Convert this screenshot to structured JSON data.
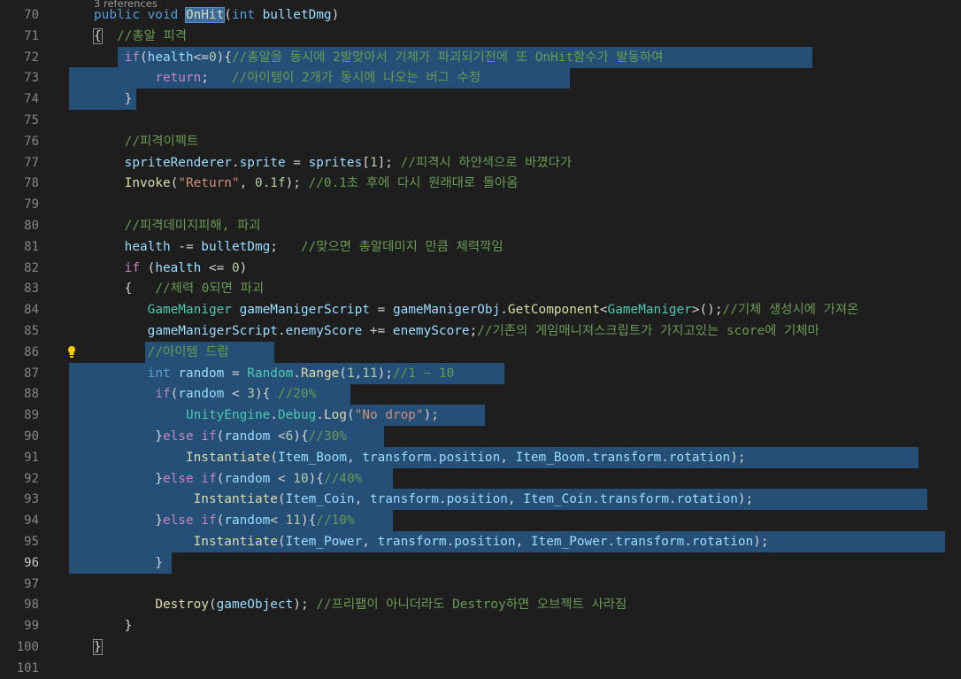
{
  "editor": {
    "codelens": "3 references",
    "lines": [
      {
        "n": "70",
        "tokens": [
          [
            "tk",
            "public void "
          ],
          [
            "fn hl",
            "OnHit"
          ],
          [
            "pl",
            "("
          ],
          [
            "tk",
            "int "
          ],
          [
            "vr",
            "bulletDmg"
          ],
          [
            "pl",
            ")"
          ]
        ]
      },
      {
        "n": "71",
        "tokens": [
          [
            "pl br",
            "{"
          ],
          [
            "cm",
            "  //총알 피격"
          ]
        ]
      },
      {
        "n": "72",
        "tokens": [
          [
            "pl",
            "    "
          ],
          [
            "pb",
            "if"
          ],
          [
            "pl",
            "("
          ],
          [
            "vr",
            "health"
          ],
          [
            "pl",
            "<="
          ],
          [
            "nm",
            "0"
          ],
          [
            "pl",
            "){"
          ],
          [
            "cm",
            "//총알을 동시에 2발맞아서 기체가 파괴되기전에 또 OnHit함수가 발동하여"
          ]
        ]
      },
      {
        "n": "73",
        "tokens": [
          [
            "pl",
            "        "
          ],
          [
            "pb",
            "return"
          ],
          [
            "pl",
            ";   "
          ],
          [
            "cm",
            "//아이템이 2개가 동시에 나오는 버그 수정"
          ]
        ]
      },
      {
        "n": "74",
        "tokens": [
          [
            "pl",
            "    }"
          ]
        ]
      },
      {
        "n": "75",
        "tokens": []
      },
      {
        "n": "76",
        "tokens": [
          [
            "pl",
            "    "
          ],
          [
            "cm",
            "//피격이펙트"
          ]
        ]
      },
      {
        "n": "77",
        "tokens": [
          [
            "pl",
            "    "
          ],
          [
            "vr",
            "spriteRenderer"
          ],
          [
            "pl",
            "."
          ],
          [
            "vr",
            "sprite"
          ],
          [
            "pl",
            " = "
          ],
          [
            "vr",
            "sprites"
          ],
          [
            "pl",
            "["
          ],
          [
            "nm",
            "1"
          ],
          [
            "pl",
            "]; "
          ],
          [
            "cm",
            "//피격시 하얀색으로 바꼈다가"
          ]
        ]
      },
      {
        "n": "78",
        "tokens": [
          [
            "pl",
            "    "
          ],
          [
            "fn",
            "Invoke"
          ],
          [
            "pl",
            "("
          ],
          [
            "st",
            "\"Return\""
          ],
          [
            "pl",
            ", "
          ],
          [
            "nm",
            "0.1f"
          ],
          [
            "pl",
            "); "
          ],
          [
            "cm",
            "//0.1초 후에 다시 원래대로 돌아옴"
          ]
        ]
      },
      {
        "n": "79",
        "tokens": []
      },
      {
        "n": "80",
        "tokens": [
          [
            "pl",
            "    "
          ],
          [
            "cm",
            "//피격데미지피해, 파괴"
          ]
        ]
      },
      {
        "n": "81",
        "tokens": [
          [
            "pl",
            "    "
          ],
          [
            "vr",
            "health"
          ],
          [
            "pl",
            " -= "
          ],
          [
            "vr",
            "bulletDmg"
          ],
          [
            "pl",
            ";   "
          ],
          [
            "cm",
            "//맞으면 총알데미지 만큼 체력깍임"
          ]
        ]
      },
      {
        "n": "82",
        "tokens": [
          [
            "pl",
            "    "
          ],
          [
            "pb",
            "if"
          ],
          [
            "pl",
            " ("
          ],
          [
            "vr",
            "health"
          ],
          [
            "pl",
            " <= "
          ],
          [
            "nm",
            "0"
          ],
          [
            "pl",
            ")"
          ]
        ]
      },
      {
        "n": "83",
        "tokens": [
          [
            "pl",
            "    {   "
          ],
          [
            "cm",
            "//체력 0되면 파괴"
          ]
        ]
      },
      {
        "n": "84",
        "tokens": [
          [
            "pl",
            "       "
          ],
          [
            "ty",
            "GameManiger"
          ],
          [
            "pl",
            " "
          ],
          [
            "vr",
            "gameManigerScript"
          ],
          [
            "pl",
            " = "
          ],
          [
            "vr",
            "gameManigerObj"
          ],
          [
            "pl",
            "."
          ],
          [
            "fn",
            "GetComponent"
          ],
          [
            "pl",
            "<"
          ],
          [
            "ty",
            "GameManiger"
          ],
          [
            "pl",
            ">();"
          ],
          [
            "cm",
            "//기체 생성시에 가져온"
          ]
        ]
      },
      {
        "n": "85",
        "tokens": [
          [
            "pl",
            "       "
          ],
          [
            "vr",
            "gameManigerScript"
          ],
          [
            "pl",
            "."
          ],
          [
            "vr",
            "enemyScore"
          ],
          [
            "pl",
            " += "
          ],
          [
            "vr",
            "enemyScore"
          ],
          [
            "pl",
            ";"
          ],
          [
            "cm",
            "//기존의 게임매니져스크립트가 가지고있는 score에 기체마"
          ]
        ]
      },
      {
        "n": "86",
        "tokens": [
          [
            "pl",
            "       "
          ],
          [
            "cm",
            "//아이템 드랍"
          ]
        ]
      },
      {
        "n": "87",
        "tokens": [
          [
            "pl",
            "       "
          ],
          [
            "tk",
            "int "
          ],
          [
            "vr",
            "random"
          ],
          [
            "pl",
            " = "
          ],
          [
            "ty",
            "Random"
          ],
          [
            "pl",
            "."
          ],
          [
            "fn",
            "Range"
          ],
          [
            "pl",
            "("
          ],
          [
            "nm",
            "1"
          ],
          [
            "pl",
            ","
          ],
          [
            "nm",
            "11"
          ],
          [
            "pl",
            ");"
          ],
          [
            "cm",
            "//1 ~ 10"
          ]
        ]
      },
      {
        "n": "88",
        "tokens": [
          [
            "pl",
            "        "
          ],
          [
            "pb",
            "if"
          ],
          [
            "pl",
            "("
          ],
          [
            "vr",
            "random"
          ],
          [
            "pl",
            " < "
          ],
          [
            "nm",
            "3"
          ],
          [
            "pl",
            ")"
          ],
          [
            "pl",
            "{ "
          ],
          [
            "cm",
            "//20%"
          ]
        ]
      },
      {
        "n": "89",
        "tokens": [
          [
            "pl",
            "            "
          ],
          [
            "ty",
            "UnityEngine"
          ],
          [
            "pl",
            "."
          ],
          [
            "ty",
            "Debug"
          ],
          [
            "pl",
            "."
          ],
          [
            "fn",
            "Log"
          ],
          [
            "pl",
            "("
          ],
          [
            "st",
            "\"No drop\""
          ],
          [
            "pl",
            ");"
          ]
        ]
      },
      {
        "n": "90",
        "tokens": [
          [
            "pl",
            "        }"
          ],
          [
            "pb",
            "else if"
          ],
          [
            "pl",
            "("
          ],
          [
            "vr",
            "random"
          ],
          [
            "pl",
            " <"
          ],
          [
            "nm",
            "6"
          ],
          [
            "pl",
            "){"
          ],
          [
            "cm",
            "//30%"
          ]
        ]
      },
      {
        "n": "91",
        "tokens": [
          [
            "pl",
            "            "
          ],
          [
            "fn",
            "Instantiate"
          ],
          [
            "pl",
            "("
          ],
          [
            "vr",
            "Item_Boom"
          ],
          [
            "pl",
            ", "
          ],
          [
            "vr",
            "transform"
          ],
          [
            "pl",
            "."
          ],
          [
            "vr",
            "position"
          ],
          [
            "pl",
            ", "
          ],
          [
            "vr",
            "Item_Boom"
          ],
          [
            "pl",
            "."
          ],
          [
            "vr",
            "transform"
          ],
          [
            "pl",
            "."
          ],
          [
            "vr",
            "rotation"
          ],
          [
            "pl",
            ");"
          ]
        ]
      },
      {
        "n": "92",
        "tokens": [
          [
            "pl",
            "        }"
          ],
          [
            "pb",
            "else if"
          ],
          [
            "pl",
            "("
          ],
          [
            "vr",
            "random"
          ],
          [
            "pl",
            " < "
          ],
          [
            "nm",
            "10"
          ],
          [
            "pl",
            "){"
          ],
          [
            "cm",
            "//40%"
          ]
        ]
      },
      {
        "n": "93",
        "tokens": [
          [
            "pl",
            "             "
          ],
          [
            "fn",
            "Instantiate"
          ],
          [
            "pl",
            "("
          ],
          [
            "vr",
            "Item_Coin"
          ],
          [
            "pl",
            ", "
          ],
          [
            "vr",
            "transform"
          ],
          [
            "pl",
            "."
          ],
          [
            "vr",
            "position"
          ],
          [
            "pl",
            ", "
          ],
          [
            "vr",
            "Item_Coin"
          ],
          [
            "pl",
            "."
          ],
          [
            "vr",
            "transform"
          ],
          [
            "pl",
            "."
          ],
          [
            "vr",
            "rotation"
          ],
          [
            "pl",
            ");"
          ]
        ]
      },
      {
        "n": "94",
        "tokens": [
          [
            "pl",
            "        }"
          ],
          [
            "pb",
            "else if"
          ],
          [
            "pl",
            "("
          ],
          [
            "vr",
            "random"
          ],
          [
            "pl",
            "< "
          ],
          [
            "nm",
            "11"
          ],
          [
            "pl",
            "){"
          ],
          [
            "cm",
            "//10%"
          ]
        ]
      },
      {
        "n": "95",
        "tokens": [
          [
            "pl",
            "             "
          ],
          [
            "fn",
            "Instantiate"
          ],
          [
            "pl",
            "("
          ],
          [
            "vr",
            "Item_Power"
          ],
          [
            "pl",
            ", "
          ],
          [
            "vr",
            "transform"
          ],
          [
            "pl",
            "."
          ],
          [
            "vr",
            "position"
          ],
          [
            "pl",
            ", "
          ],
          [
            "vr",
            "Item_Power"
          ],
          [
            "pl",
            "."
          ],
          [
            "vr",
            "transform"
          ],
          [
            "pl",
            "."
          ],
          [
            "vr",
            "rotation"
          ],
          [
            "pl",
            ");"
          ]
        ]
      },
      {
        "n": "96",
        "tokens": [
          [
            "pl",
            "        }"
          ]
        ],
        "active": true
      },
      {
        "n": "97",
        "tokens": []
      },
      {
        "n": "98",
        "tokens": [
          [
            "pl",
            "        "
          ],
          [
            "fn",
            "Destroy"
          ],
          [
            "pl",
            "("
          ],
          [
            "vr",
            "gameObject"
          ],
          [
            "pl",
            "); "
          ],
          [
            "cm",
            "//프리팹이 아니더라도 Destroy하면 오브젝트 사라짐"
          ]
        ]
      },
      {
        "n": "99",
        "tokens": [
          [
            "pl",
            "    }"
          ]
        ]
      },
      {
        "n": "100",
        "tokens": [
          [
            "pl br",
            "}"
          ]
        ]
      },
      {
        "n": "101",
        "tokens": []
      }
    ]
  }
}
